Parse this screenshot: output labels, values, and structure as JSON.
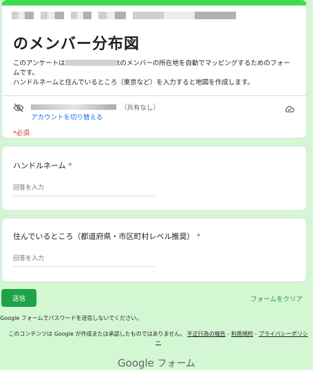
{
  "form": {
    "title": "のメンバー分布図",
    "description_pre": "このアンケートは",
    "description_mid": "tのメンバーの所在地を自動でマッピングするためのフォームです。",
    "description_line2": "ハンドルネームと住んでいるところ（東京など）を入力すると地図を作成します。",
    "share_note": "（共有なし）",
    "switch_account": "アカウントを切り替える",
    "required_note": "*必須"
  },
  "questions": [
    {
      "label": "ハンドルネーム",
      "required_mark": "*",
      "placeholder": "回答を入力"
    },
    {
      "label": "住んでいるところ（都道府県・市区町村レベル推奨）",
      "required_mark": "*",
      "placeholder": "回答を入力"
    }
  ],
  "actions": {
    "submit": "送信",
    "clear": "フォームをクリア"
  },
  "footer": {
    "password_note": "Google フォームでパスワードを送信しないでください。",
    "disclaimer": "このコンテンツは Google が作成または承認したものではありません。",
    "report_link": "不正行為の報告",
    "sep1": "-",
    "terms_link": "利用規約",
    "sep2": "-",
    "privacy_link": "プライバシーポリシー",
    "brand_google": "Google",
    "brand_forms": "フォーム"
  },
  "colors": {
    "background": "#d4f7d3",
    "accent": "#3ddc4e",
    "submit": "#1ea446",
    "required": "#d93025",
    "link": "#1a73e8"
  },
  "icons": [
    "eye-off-icon",
    "cloud-icon"
  ]
}
